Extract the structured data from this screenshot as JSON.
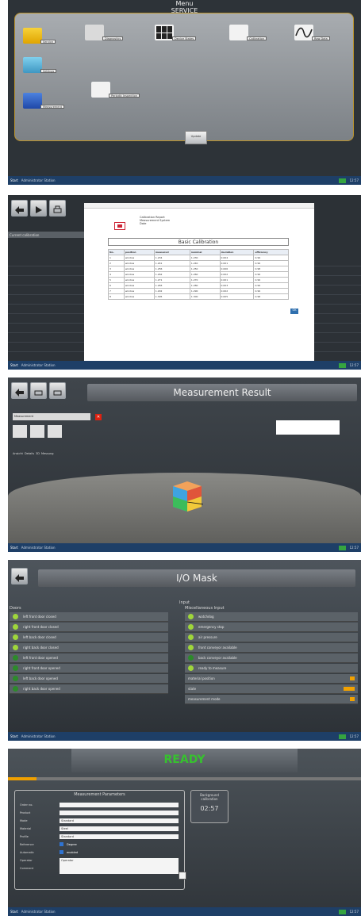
{
  "taskbar": {
    "start": "Start",
    "app": "Administrator Station",
    "clock": "12:57"
  },
  "panel1": {
    "title": "Menu",
    "subtitle": "SERVICE",
    "items": [
      {
        "label": "Service",
        "icon": "wrench-gear-icon",
        "color": "#f0c000"
      },
      {
        "label": "Diagnostics",
        "icon": "car-wrench-icon",
        "color": "#dcdcdc"
      },
      {
        "label": "Device States",
        "icon": "grid-icon",
        "color": "#f2f2f2"
      },
      {
        "label": "Calibration",
        "icon": "calibration-icon",
        "color": "#f2f2f2"
      },
      {
        "label": "Raw Data",
        "icon": "waveform-icon",
        "color": "#f2f2f2"
      },
      {
        "label": "Settings",
        "icon": "gear-icon",
        "color": "#57b0d6"
      },
      {
        "label": "Periodic Inspection",
        "icon": "checklist-icon",
        "color": "#f2f2f2"
      },
      {
        "label": "Measurement",
        "icon": "measure-icon",
        "color": "#3266c8"
      }
    ],
    "update": "Update"
  },
  "panel2": {
    "sidebar_header": "Current calibration",
    "pdf": {
      "header_lines": [
        "Calibration Report",
        "Measurement System",
        "Date"
      ],
      "title": "Basic Calibration",
      "columns": [
        "No.",
        "position",
        "measured",
        "nominal",
        "deviation",
        "efficiency"
      ],
      "rows": [
        [
          "1",
          "window",
          "1.234",
          "1.230",
          "0.004",
          "0.99"
        ],
        [
          "2",
          "window",
          "1.241",
          "1.240",
          "0.001",
          "0.99"
        ],
        [
          "3",
          "window",
          "1.256",
          "1.250",
          "0.006",
          "0.98"
        ],
        [
          "4",
          "window",
          "1.262",
          "1.260",
          "0.002",
          "0.99"
        ],
        [
          "5",
          "window",
          "1.271",
          "1.270",
          "0.001",
          "0.99"
        ],
        [
          "6",
          "window",
          "1.283",
          "1.280",
          "0.003",
          "0.99"
        ],
        [
          "7",
          "window",
          "1.292",
          "1.290",
          "0.002",
          "0.99"
        ],
        [
          "8",
          "window",
          "1.305",
          "1.300",
          "0.005",
          "0.98"
        ]
      ],
      "ok": "OK"
    }
  },
  "panel3": {
    "title": "Measurement Result",
    "selector": "Measurement",
    "tabs": [
      "Ansicht",
      "Details",
      "3D",
      "Messung"
    ]
  },
  "panel4": {
    "title": "I/O Mask",
    "input": "Input",
    "doors_title": "Doors",
    "misc_title": "Miscellaneous Input",
    "doors": [
      {
        "label": "left front door closed",
        "state": "on"
      },
      {
        "label": "right front door closed",
        "state": "on"
      },
      {
        "label": "left back door closed",
        "state": "on"
      },
      {
        "label": "right back door closed",
        "state": "on"
      },
      {
        "label": "left front door opened",
        "state": "off"
      },
      {
        "label": "right front door opened",
        "state": "off"
      },
      {
        "label": "left back door opened",
        "state": "off"
      },
      {
        "label": "right back door opened",
        "state": "off"
      }
    ],
    "misc": [
      {
        "label": "watchdog",
        "state": "on"
      },
      {
        "label": "emergency stop",
        "state": "on"
      },
      {
        "label": "air pressure",
        "state": "on"
      },
      {
        "label": "front conveyor available",
        "state": "on"
      },
      {
        "label": "back conveyor available",
        "state": "off"
      },
      {
        "label": "ready to measure",
        "state": "on"
      },
      {
        "label": "material position",
        "state": "tag"
      },
      {
        "label": "state",
        "state": "tagw"
      },
      {
        "label": "measurement mode",
        "state": "tag"
      }
    ]
  },
  "panel5": {
    "status": "READY",
    "progress": 0.08,
    "params_title": "Measurement Parameters",
    "params": [
      {
        "label": "Order no.",
        "value": ""
      },
      {
        "label": "Product",
        "value": ""
      },
      {
        "label": "Mode",
        "value": "Standard"
      },
      {
        "label": "Material",
        "value": "Steel"
      },
      {
        "label": "Profile",
        "value": "Standard"
      },
      {
        "label": "Reference",
        "value": "Degree"
      },
      {
        "label": "Automatic",
        "value": "enabled"
      },
      {
        "label": "Operator",
        "value": "Operator"
      },
      {
        "label": "Comment",
        "value": ""
      }
    ],
    "bg_title": "Background calibration",
    "bg_time": "02:57"
  }
}
